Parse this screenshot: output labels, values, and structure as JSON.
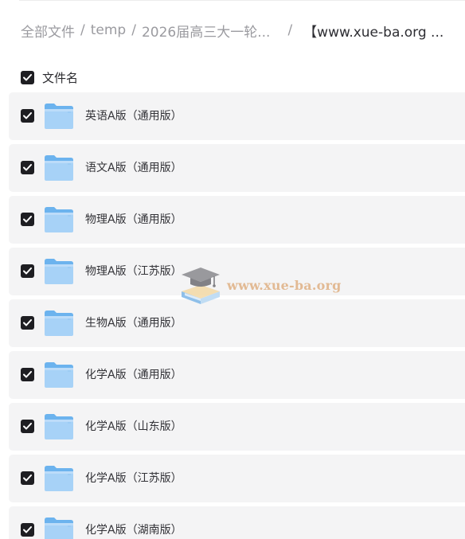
{
  "breadcrumb": {
    "items": [
      "全部文件",
      "temp",
      "2026届高三大一轮..."
    ],
    "separator": "/",
    "current": "【www.xue-ba.org ..."
  },
  "list_header": {
    "label": "文件名",
    "select_all_checked": true
  },
  "files": [
    {
      "name": "英语A版（通用版）",
      "type": "folder",
      "checked": true
    },
    {
      "name": "语文A版（通用版）",
      "type": "folder",
      "checked": true
    },
    {
      "name": "物理A版（通用版）",
      "type": "folder",
      "checked": true
    },
    {
      "name": "物理A版（江苏版）",
      "type": "folder",
      "checked": true
    },
    {
      "name": "生物A版（通用版）",
      "type": "folder",
      "checked": true
    },
    {
      "name": "化学A版（通用版）",
      "type": "folder",
      "checked": true
    },
    {
      "name": "化学A版（山东版）",
      "type": "folder",
      "checked": true
    },
    {
      "name": "化学A版（江苏版）",
      "type": "folder",
      "checked": true
    },
    {
      "name": "化学A版（湖南版）",
      "type": "folder",
      "checked": true
    }
  ],
  "watermark": {
    "text": "www.xue-ba.org",
    "icon": "graduation-cap-books-icon"
  },
  "colors": {
    "row_background": "#f4f4f5",
    "checkbox": "#1e1e22",
    "folder_light": "#a7d2f7",
    "folder_dark": "#6cb3ee",
    "breadcrumb_text": "#9b9ba0",
    "watermark_text": "#e0b184"
  }
}
